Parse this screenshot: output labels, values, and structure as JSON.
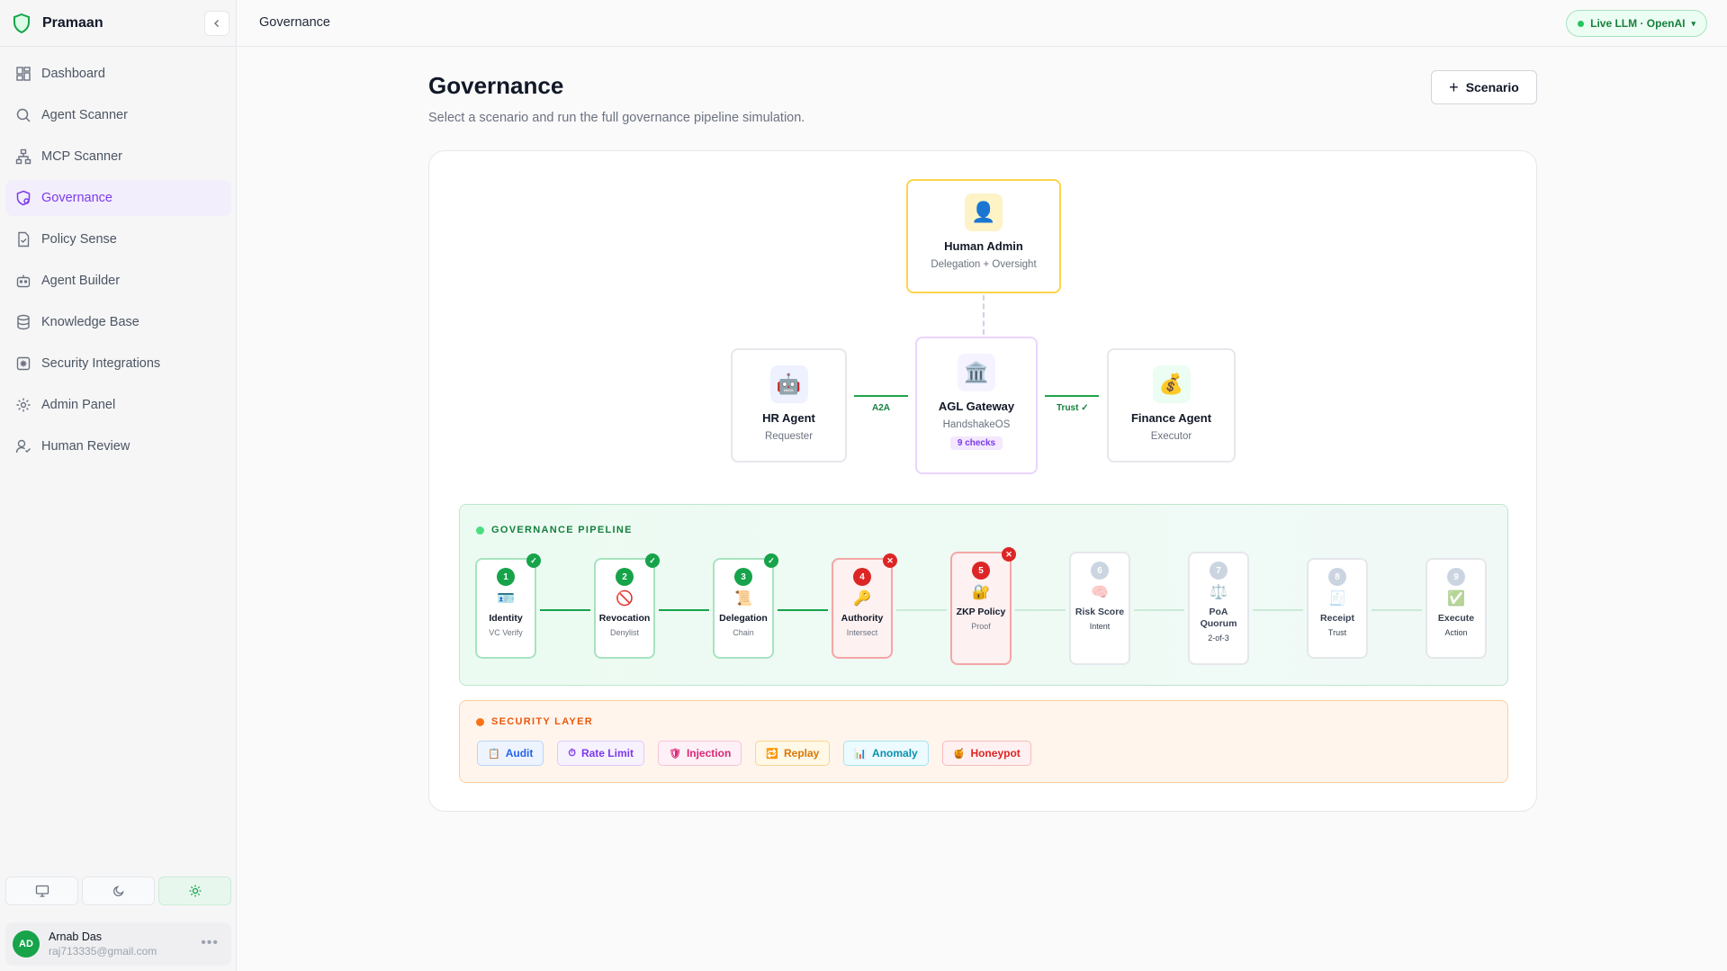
{
  "app": {
    "name": "Pramaan"
  },
  "sidebar": {
    "items": [
      {
        "label": "Dashboard",
        "icon": "dashboard-icon"
      },
      {
        "label": "Agent Scanner",
        "icon": "search-icon"
      },
      {
        "label": "MCP Scanner",
        "icon": "network-icon"
      },
      {
        "label": "Governance",
        "icon": "shield-icon",
        "active": true
      },
      {
        "label": "Policy Sense",
        "icon": "document-check-icon"
      },
      {
        "label": "Agent Builder",
        "icon": "bot-icon"
      },
      {
        "label": "Knowledge Base",
        "icon": "database-icon"
      },
      {
        "label": "Security Integrations",
        "icon": "puzzle-icon"
      },
      {
        "label": "Admin Panel",
        "icon": "gear-icon"
      },
      {
        "label": "Human Review",
        "icon": "user-check-icon"
      }
    ],
    "theme_options": [
      "system",
      "dark",
      "light"
    ],
    "theme_active": "light",
    "user": {
      "initials": "AD",
      "name": "Arnab Das",
      "email": "raj713335@gmail.com"
    }
  },
  "topbar": {
    "breadcrumb": "Governance",
    "llm_badge": "Live LLM · OpenAI"
  },
  "page": {
    "title": "Governance",
    "subtitle": "Select a scenario and run the full governance pipeline simulation.",
    "scenario_button": "Scenario"
  },
  "flow": {
    "human_admin": {
      "name": "Human Admin",
      "role": "Delegation + Oversight"
    },
    "hr_agent": {
      "name": "HR Agent",
      "role": "Requester"
    },
    "gateway": {
      "name": "AGL Gateway",
      "role": "HandshakeOS",
      "checks": "9 checks"
    },
    "finance_agent": {
      "name": "Finance Agent",
      "role": "Executor"
    },
    "edge_a2a": "A2A",
    "edge_trust": "Trust ✓"
  },
  "pipeline": {
    "title": "GOVERNANCE PIPELINE",
    "stages": [
      {
        "num": "1",
        "name": "Identity",
        "sub": "VC Verify",
        "status": "done",
        "icon": "🪪"
      },
      {
        "num": "2",
        "name": "Revocation",
        "sub": "Denylist",
        "status": "done",
        "icon": "🚫"
      },
      {
        "num": "3",
        "name": "Delegation",
        "sub": "Chain",
        "status": "done",
        "icon": "📜"
      },
      {
        "num": "4",
        "name": "Authority",
        "sub": "Intersect",
        "status": "fail",
        "icon": "🔑"
      },
      {
        "num": "5",
        "name": "ZKP Policy",
        "sub": "Proof",
        "status": "fail",
        "icon": "🔐"
      },
      {
        "num": "6",
        "name": "Risk Score",
        "sub": "Intent",
        "status": "pending",
        "icon": "🧠"
      },
      {
        "num": "7",
        "name": "PoA Quorum",
        "sub": "2-of-3",
        "status": "pending",
        "icon": "⚖️"
      },
      {
        "num": "8",
        "name": "Receipt",
        "sub": "Trust",
        "status": "pending",
        "icon": "🧾"
      },
      {
        "num": "9",
        "name": "Execute",
        "sub": "Action",
        "status": "pending",
        "icon": "✅"
      }
    ]
  },
  "security": {
    "title": "SECURITY LAYER",
    "chips": [
      {
        "label": "Audit",
        "icon": "📋",
        "color": "#2563eb",
        "bg": "#eef4ff",
        "border": "#bcd2fb"
      },
      {
        "label": "Rate Limit",
        "icon": "⏱",
        "color": "#7c3aed",
        "bg": "#f7f2ff",
        "border": "#dccbfb"
      },
      {
        "label": "Injection",
        "icon": "🛡",
        "color": "#db2777",
        "bg": "#fdf1f7",
        "border": "#f6c4dc"
      },
      {
        "label": "Replay",
        "icon": "🔁",
        "color": "#d97706",
        "bg": "#fff8e6",
        "border": "#f7d68f"
      },
      {
        "label": "Anomaly",
        "icon": "📊",
        "color": "#0891b2",
        "bg": "#ecfbff",
        "border": "#a8e3f0"
      },
      {
        "label": "Honeypot",
        "icon": "🍯",
        "color": "#dc2626",
        "bg": "#fff1f1",
        "border": "#f5bcbc"
      }
    ]
  },
  "colors": {
    "accent": "#7c3aed",
    "success": "#16a34a",
    "danger": "#dc2626",
    "pending": "#cbd5e1"
  }
}
